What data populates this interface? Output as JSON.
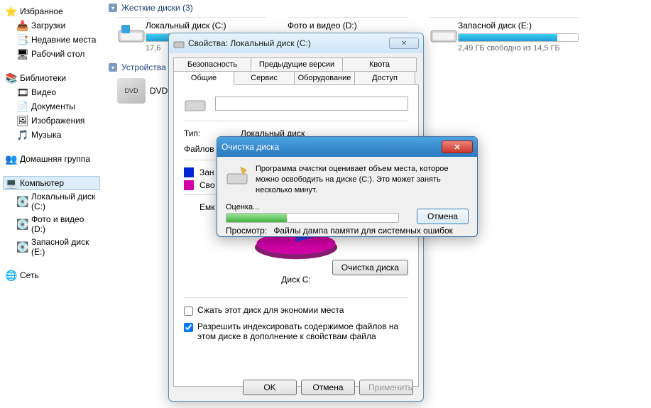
{
  "sidebar": {
    "favorites": {
      "label": "Избранное"
    },
    "favorites_items": [
      {
        "label": "Загрузки"
      },
      {
        "label": "Недавние места"
      },
      {
        "label": "Рабочий стол"
      }
    ],
    "libraries": {
      "label": "Библиотеки"
    },
    "libraries_items": [
      {
        "label": "Видео"
      },
      {
        "label": "Документы"
      },
      {
        "label": "Изображения"
      },
      {
        "label": "Музыка"
      }
    ],
    "homegroup": {
      "label": "Домашняя группа"
    },
    "computer": {
      "label": "Компьютер"
    },
    "computer_items": [
      {
        "label": "Локальный диск (C:)"
      },
      {
        "label": "Фото и видео (D:)"
      },
      {
        "label": "Запасной диск (E:)"
      }
    ],
    "network": {
      "label": "Сеть"
    }
  },
  "main": {
    "hdd_header": "Жесткие диски (3)",
    "drives": [
      {
        "name": "Локальный диск (C:)",
        "free_text": "17,6",
        "fill_pct": 70
      },
      {
        "name": "Фото и видео (D:)",
        "free_text": "",
        "fill_pct": 62
      },
      {
        "name": "Запасной диск (E:)",
        "free_text": "2,49 ГБ свободно из 14,5 ГБ",
        "fill_pct": 83
      }
    ],
    "devices_header": "Устройства",
    "dvd_label": "DVD"
  },
  "props": {
    "title": "Свойства: Локальный диск (C:)",
    "tabs_top": [
      "Безопасность",
      "Предыдущие версии",
      "Квота"
    ],
    "tabs_bottom": [
      "Общие",
      "Сервис",
      "Оборудование",
      "Доступ"
    ],
    "type_label": "Тип:",
    "type_value": "Локальный диск",
    "fs_label": "Файлов",
    "used_label": "Зан",
    "free_label": "Сво",
    "capacity_label": "Емк",
    "disk_label": "Диск C:",
    "cleanup_btn": "Очистка диска",
    "compress_label": "Сжать этот диск для экономии места",
    "index_label": "Разрешить индексировать содержимое файлов на этом диске в дополнение к свойствам файла",
    "ok": "OK",
    "cancel": "Отмена",
    "apply": "Применить"
  },
  "cleanup": {
    "title": "Очистка диска",
    "message": "Программа очистки оценивает объем места, которое можно освободить на диске  (C:). Это может занять несколько минут.",
    "eval_label": "Оценка...",
    "cancel": "Отмена",
    "view_label": "Просмотр:",
    "view_value": "Файлы дампа памяти для системных ошибок"
  }
}
